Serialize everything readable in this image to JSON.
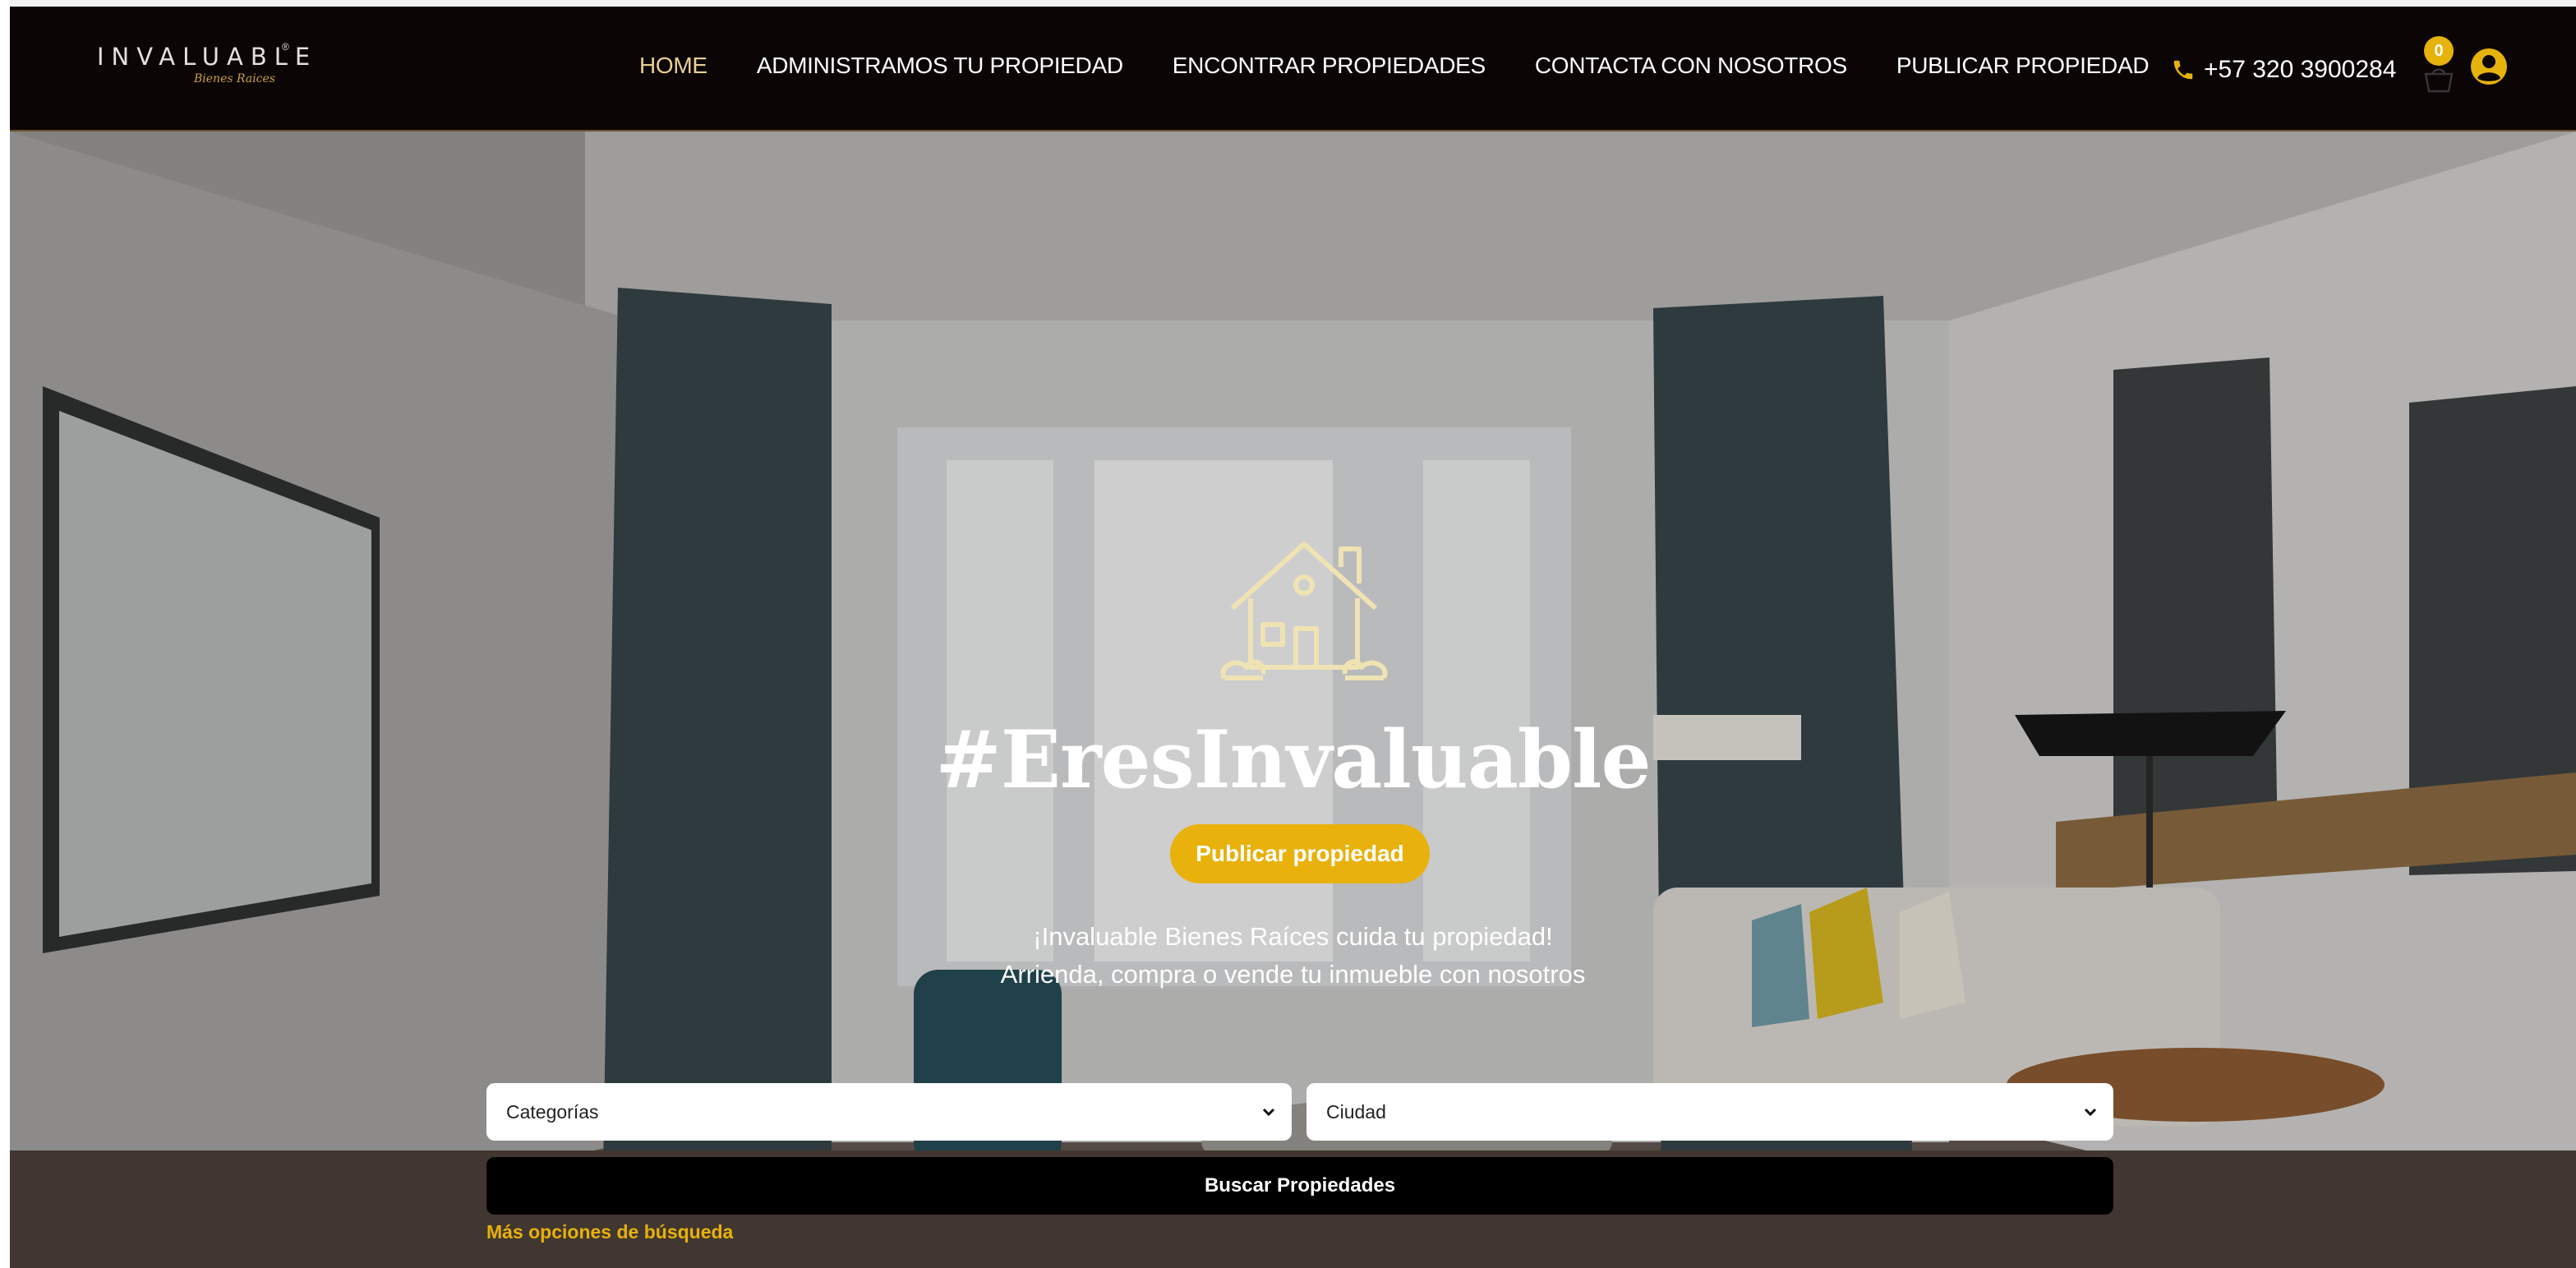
{
  "brand": {
    "logo_text": "INVALUABLE",
    "logo_registered": "®",
    "logo_subtext": "Bienes Raices",
    "accent_color": "#e8b10c",
    "nav_bg_color": "#0b0506"
  },
  "nav": {
    "items": [
      {
        "label": "HOME",
        "active": true
      },
      {
        "label": "ADMINISTRAMOS TU PROPIEDAD",
        "active": false
      },
      {
        "label": "ENCONTRAR PROPIEDADES",
        "active": false
      },
      {
        "label": "CONTACTA CON NOSOTROS",
        "active": false
      },
      {
        "label": "PUBLICAR PROPIEDAD",
        "active": false
      }
    ]
  },
  "header": {
    "phone_icon": "phone-icon",
    "phone": "+57 320 3900284",
    "cart_icon": "shopping-bag-icon",
    "cart_count": "0",
    "user_icon": "user-circle-icon"
  },
  "hero": {
    "icon": "house-icon",
    "title": "#EresInvaluable",
    "cta_label": "Publicar propiedad",
    "tagline_1": "¡Invaluable Bienes Raíces cuida tu propiedad!",
    "tagline_2": "Arrienda, compra o vende tu inmueble con nosotros"
  },
  "search": {
    "category_value": "Categorías",
    "city_value": "Ciudad",
    "button_label": "Buscar Propiedades",
    "more_options": "Más opciones de búsqueda"
  }
}
